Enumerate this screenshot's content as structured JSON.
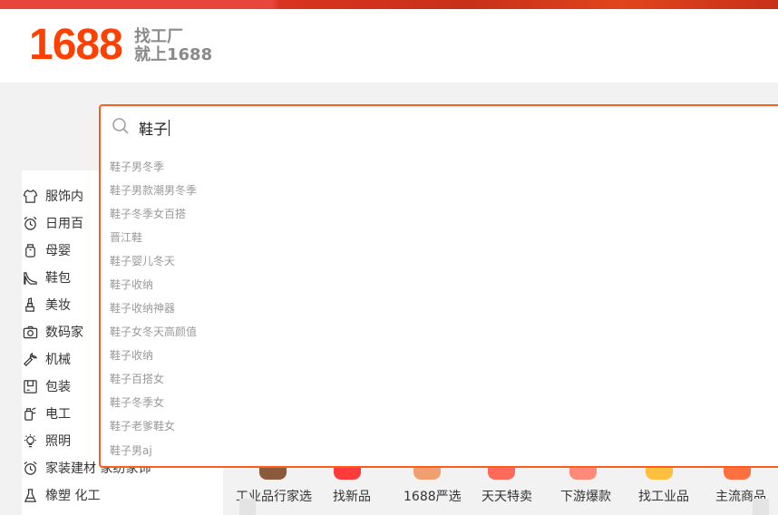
{
  "header": {
    "logo": "1688",
    "slogan_line1": "找工厂",
    "slogan_line2": "就上1688"
  },
  "search": {
    "query": "鞋子",
    "icon": "search-icon"
  },
  "suggestions": [
    "鞋子男冬季",
    "鞋子男款潮男冬季",
    "鞋子冬季女百搭",
    "晋江鞋",
    "鞋子婴儿冬天",
    "鞋子收纳",
    "鞋子收纳神器",
    "鞋子女冬天高颜值",
    "鞋子收纳",
    "鞋子百搭女",
    "鞋子冬季女",
    "鞋子老爹鞋女",
    "鞋子男aj"
  ],
  "categories": [
    {
      "label": "服饰内",
      "icon": "shirt-icon"
    },
    {
      "label": "日用百",
      "icon": "alarm-clock-icon"
    },
    {
      "label": "母婴",
      "icon": "baby-bottle-icon"
    },
    {
      "label": "鞋包",
      "icon": "high-heel-icon"
    },
    {
      "label": "美妆",
      "icon": "lipstick-icon"
    },
    {
      "label": "数码家",
      "icon": "camera-icon"
    },
    {
      "label": "机械",
      "icon": "wrench-icon"
    },
    {
      "label": "包装",
      "icon": "package-icon"
    },
    {
      "label": "电工",
      "icon": "electrical-icon"
    },
    {
      "label": "照明",
      "icon": "light-bulb-icon"
    },
    {
      "label": "家装建材 家纺家饰",
      "icon": "alarm-clock-icon"
    },
    {
      "label": "橡塑 化工",
      "icon": "flask-icon"
    }
  ],
  "bottom_nav": [
    "工业品行家选",
    "找新品",
    "1688严选",
    "天天特卖",
    "下游爆款",
    "找工业品",
    "主流商品"
  ],
  "colors": {
    "brand": "#ff4000",
    "accent_border": "#ff5a1f",
    "suggestion_text": "#999999"
  }
}
